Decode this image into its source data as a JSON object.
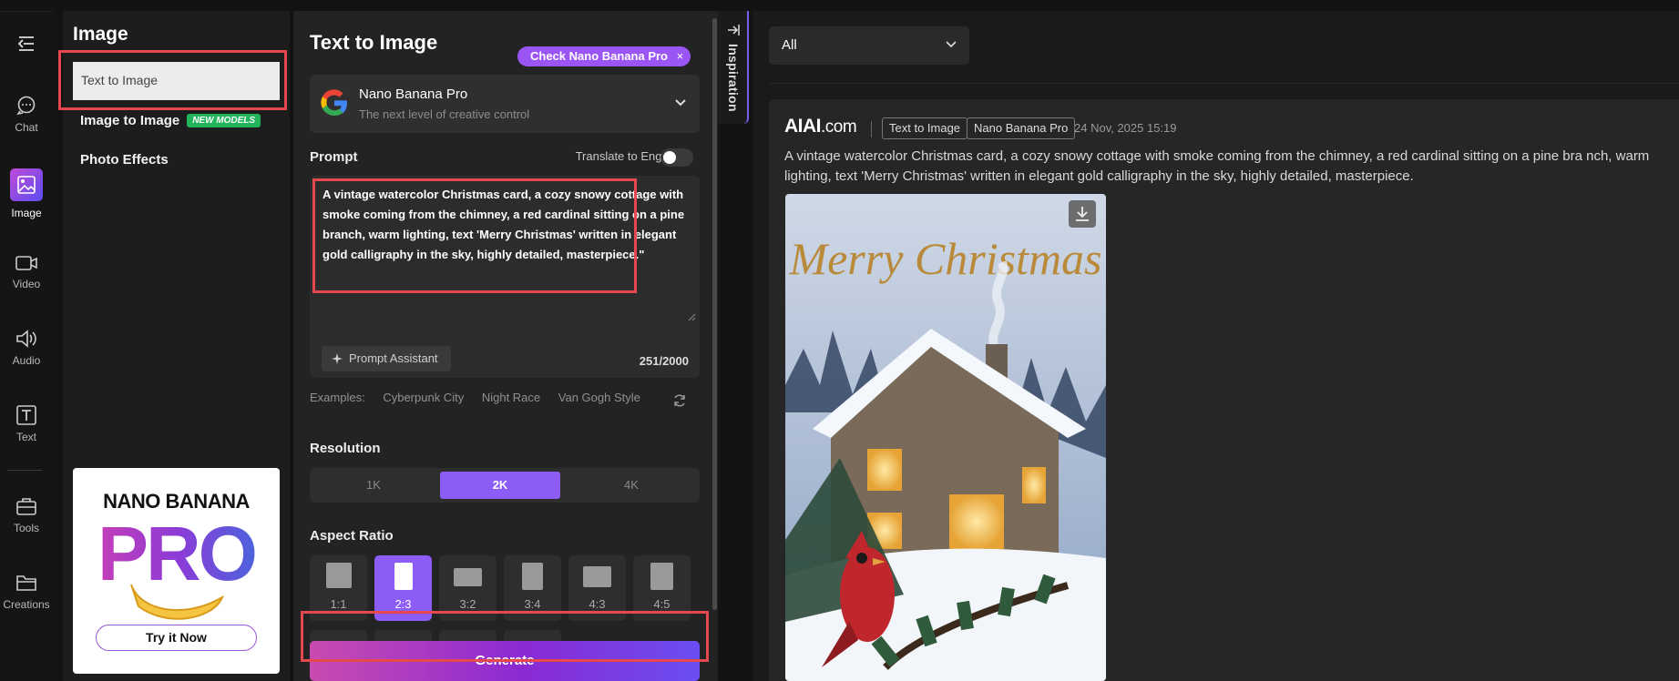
{
  "rail": {
    "items": [
      {
        "label": "Chat",
        "icon": "chat-bubble-icon"
      },
      {
        "label": "Image",
        "icon": "image-icon"
      },
      {
        "label": "Video",
        "icon": "video-camera-icon"
      },
      {
        "label": "Audio",
        "icon": "speaker-icon"
      },
      {
        "label": "Text",
        "icon": "text-t-icon"
      },
      {
        "label": "Tools",
        "icon": "toolbox-icon"
      },
      {
        "label": "Creations",
        "icon": "folder-icon"
      }
    ]
  },
  "submenu": {
    "title": "Image",
    "items": [
      "Text to Image",
      "Image to Image",
      "Photo Effects"
    ],
    "new_badge": "NEW MODELS",
    "promo": {
      "line1": "NANO BANANA",
      "line2": "PRO",
      "button": "Try it Now"
    }
  },
  "form": {
    "title": "Text to Image",
    "check_pill": "Check Nano Banana Pro",
    "model": {
      "name": "Nano Banana Pro",
      "desc": "The next level of creative control"
    },
    "prompt_label": "Prompt",
    "translate_label": "Translate to English",
    "translate_on": false,
    "prompt_text": "A vintage watercolor Christmas card, a cozy snowy cottage with smoke coming from the chimney, a red cardinal sitting on a pine branch, warm lighting, text 'Merry Christmas' written in elegant gold calligraphy in the sky, highly detailed, masterpiece.\"",
    "assistant_label": "Prompt Assistant",
    "counter": "251/2000",
    "examples_label": "Examples:",
    "examples": [
      "Cyberpunk City",
      "Night Race",
      "Van Gogh Style"
    ],
    "resolution_label": "Resolution",
    "resolutions": [
      "1K",
      "2K",
      "4K"
    ],
    "resolution_selected": "2K",
    "aspect_label": "Aspect Ratio",
    "aspects": [
      "1:1",
      "2:3",
      "3:2",
      "3:4",
      "4:3",
      "4:5"
    ],
    "aspect_selected": "2:3",
    "generate_label": "Generate",
    "inspiration_label": "Inspiration"
  },
  "right": {
    "filter_value": "All",
    "card": {
      "brand": "AIAI",
      "brand_suffix": ".com",
      "tags": [
        "Text to Image",
        "Nano Banana Pro"
      ],
      "date": "24 Nov, 2025 15:19",
      "description": "A vintage watercolor Christmas card, a cozy snowy cottage with smoke coming from the chimney, a red cardinal sitting on a pine bra nch, warm lighting, text 'Merry Christmas' written in elegant gold calligraphy in the sky, highly detailed, masterpiece.",
      "art_text": "Merry Christmas"
    }
  },
  "colors": {
    "accent": "#8b5cf6",
    "highlight": "#e5484d",
    "new_badge": "#22b45a"
  }
}
